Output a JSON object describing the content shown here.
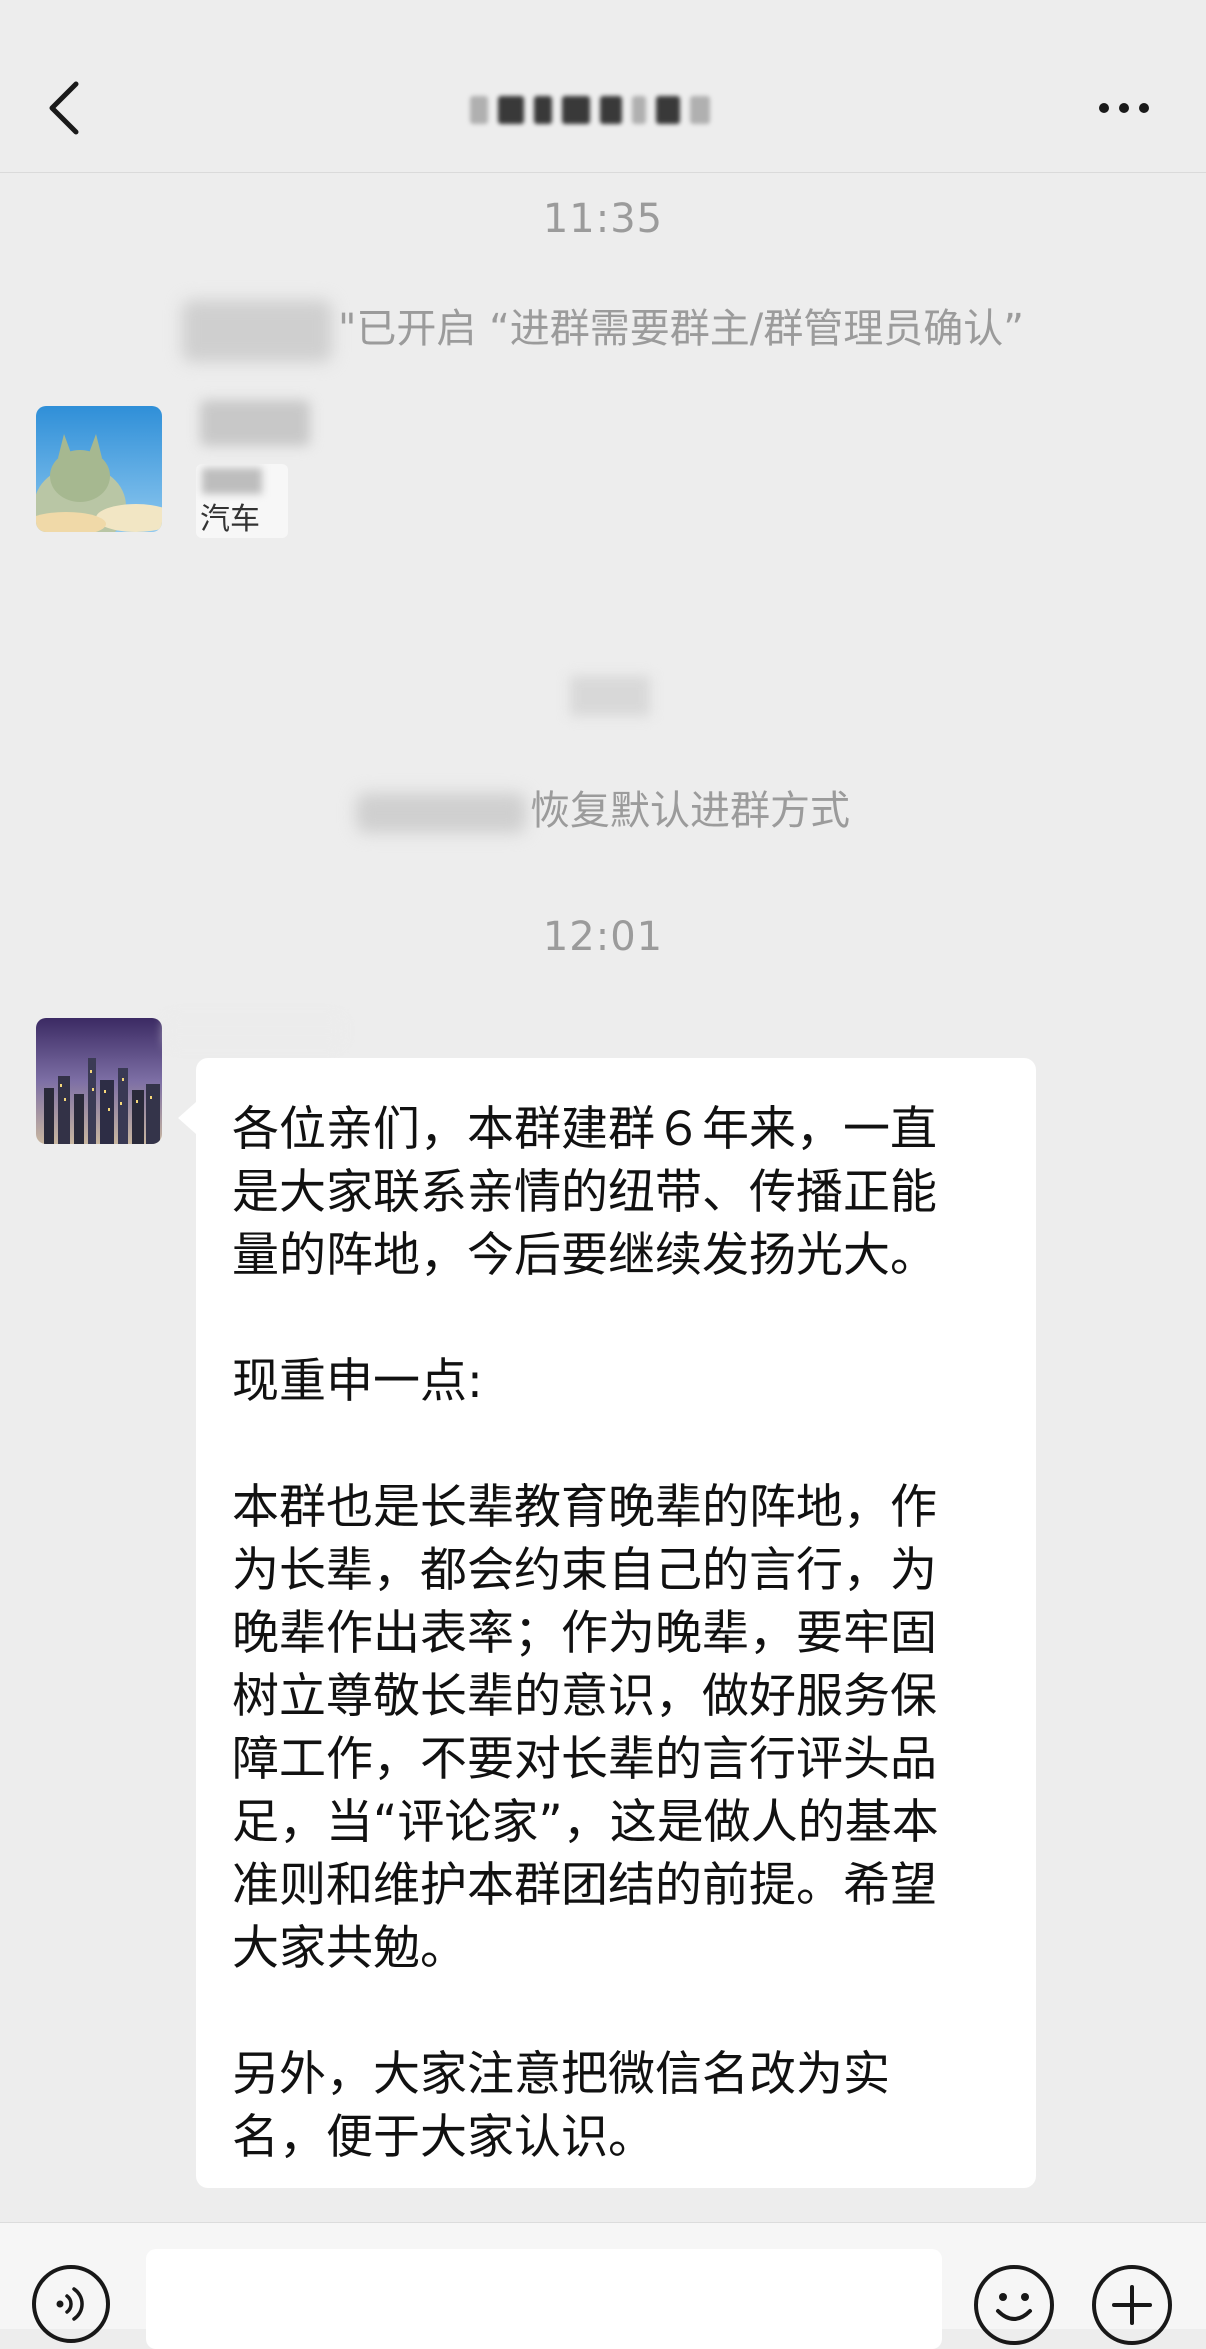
{
  "header": {
    "title": "",
    "back_icon": "chevron-left-icon",
    "more_icon": "more-dots-icon"
  },
  "messages": {
    "time_1": "11:35",
    "system_1": "\"已开启 “进群需要群主/群管理员确认”",
    "system_2": "恢复默认进群方式",
    "time_2": "12:01",
    "sticker_text": "汽车"
  },
  "main_message": {
    "lines": [
      "各位亲们，本群建群６年来，一直",
      "是大家联系亲情的纽带、传播正能",
      "量的阵地，今后要继续发扬光大。",
      "",
      "现重申一点:",
      "",
      "本群也是长辈教育晚辈的阵地，作",
      "为长辈，都会约束自己的言行，为",
      "晚辈作出表率；作为晚辈，要牢固",
      "树立尊敬长辈的意识，做好服务保",
      "障工作，不要对长辈的言行评头品",
      "足，当“评论家”，这是做人的基本",
      "准则和维护本群团结的前提。希望",
      "大家共勉。",
      "",
      "另外，大家注意把微信名改为实",
      "名，便于大家认识。"
    ]
  },
  "bottom_bar": {
    "voice_icon": "voice-icon",
    "emoji_icon": "emoji-icon",
    "plus_icon": "plus-icon",
    "input_value": ""
  },
  "colors": {
    "background": "#ededed",
    "bubble": "#ffffff",
    "system_text": "#9b9b9b"
  }
}
